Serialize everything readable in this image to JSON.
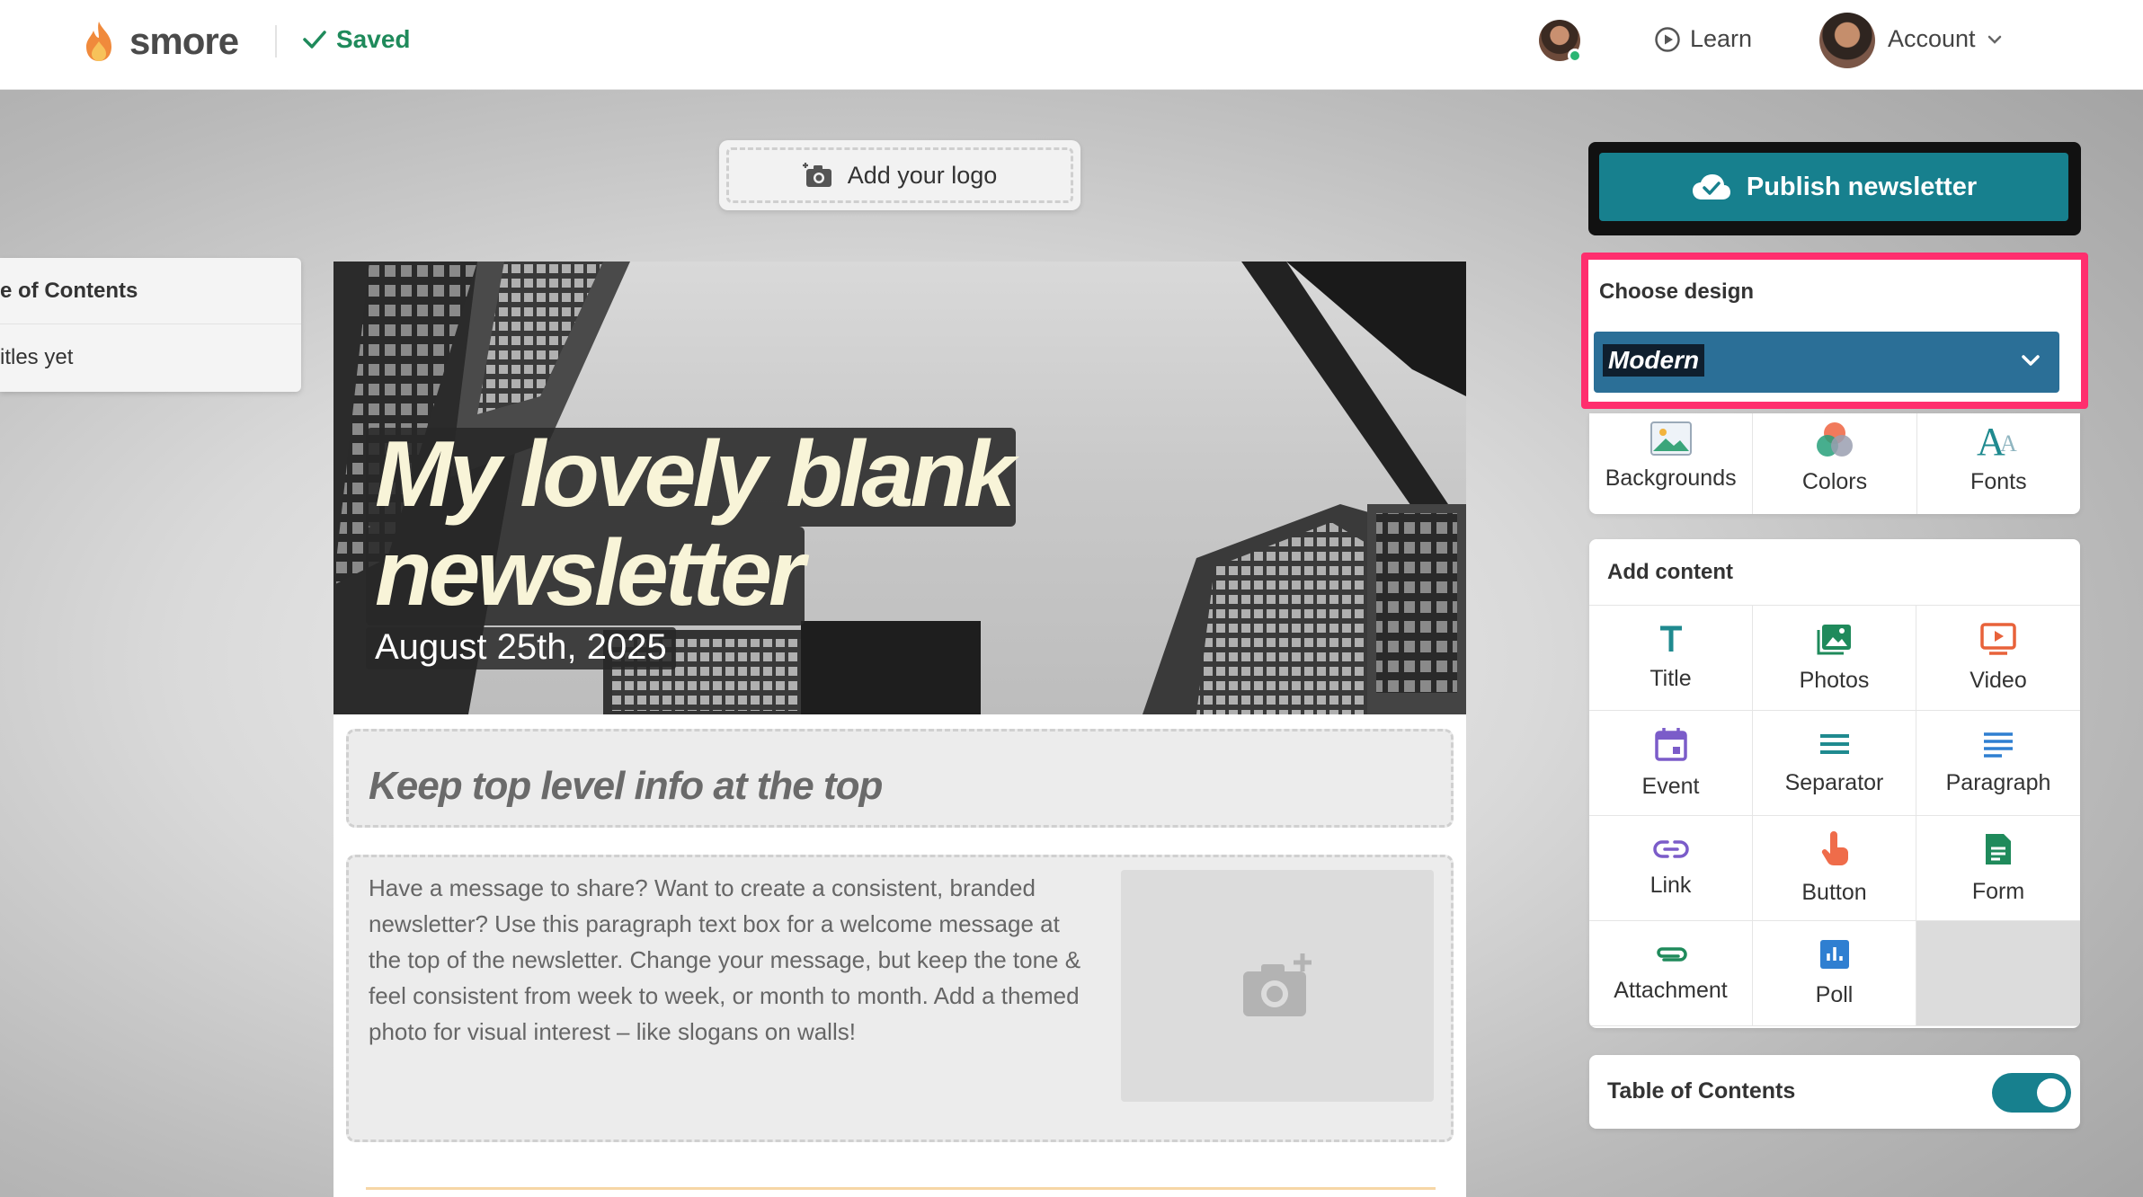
{
  "topbar": {
    "brand": "smore",
    "saved_label": "Saved",
    "learn_label": "Learn",
    "account_label": "Account"
  },
  "logo_area": {
    "label": "Add your logo"
  },
  "toc_panel": {
    "title": "e of Contents",
    "empty_text": "itles yet"
  },
  "newsletter": {
    "title_line1": "My lovely blank",
    "title_line2": "newsletter",
    "date": "August 25th, 2025",
    "section_heading": "Keep top level info at the top",
    "paragraph": "Have a message to share? Want to create a consistent, branded newsletter? Use this paragraph text box for a welcome message at the top of the newsletter. Change your message, but keep the tone & feel consistent from week to week, or month to month. Add a themed photo for visual interest – like slogans on walls!"
  },
  "right_panel": {
    "publish_label": "Publish newsletter",
    "design_label": "Choose design",
    "design_value": "Modern",
    "style_options": [
      {
        "label": "Backgrounds",
        "icon": "image-icon"
      },
      {
        "label": "Colors",
        "icon": "colors-icon"
      },
      {
        "label": "Fonts",
        "icon": "fonts-icon"
      }
    ],
    "add_content_label": "Add content",
    "content_items": [
      {
        "label": "Title",
        "icon": "title-icon"
      },
      {
        "label": "Photos",
        "icon": "photos-icon"
      },
      {
        "label": "Video",
        "icon": "video-icon"
      },
      {
        "label": "Event",
        "icon": "calendar-icon"
      },
      {
        "label": "Separator",
        "icon": "separator-icon"
      },
      {
        "label": "Paragraph",
        "icon": "paragraph-icon"
      },
      {
        "label": "Link",
        "icon": "link-icon"
      },
      {
        "label": "Button",
        "icon": "pointer-icon"
      },
      {
        "label": "Form",
        "icon": "form-icon"
      },
      {
        "label": "Attachment",
        "icon": "attachment-icon"
      },
      {
        "label": "Poll",
        "icon": "poll-icon"
      }
    ],
    "toc_toggle_label": "Table of Contents",
    "toc_toggle_on": true
  },
  "colors": {
    "accent_teal": "#17808e",
    "design_select": "#2b6f97",
    "highlight_pink": "#ff2e6e",
    "saved_green": "#1f8a5b"
  }
}
